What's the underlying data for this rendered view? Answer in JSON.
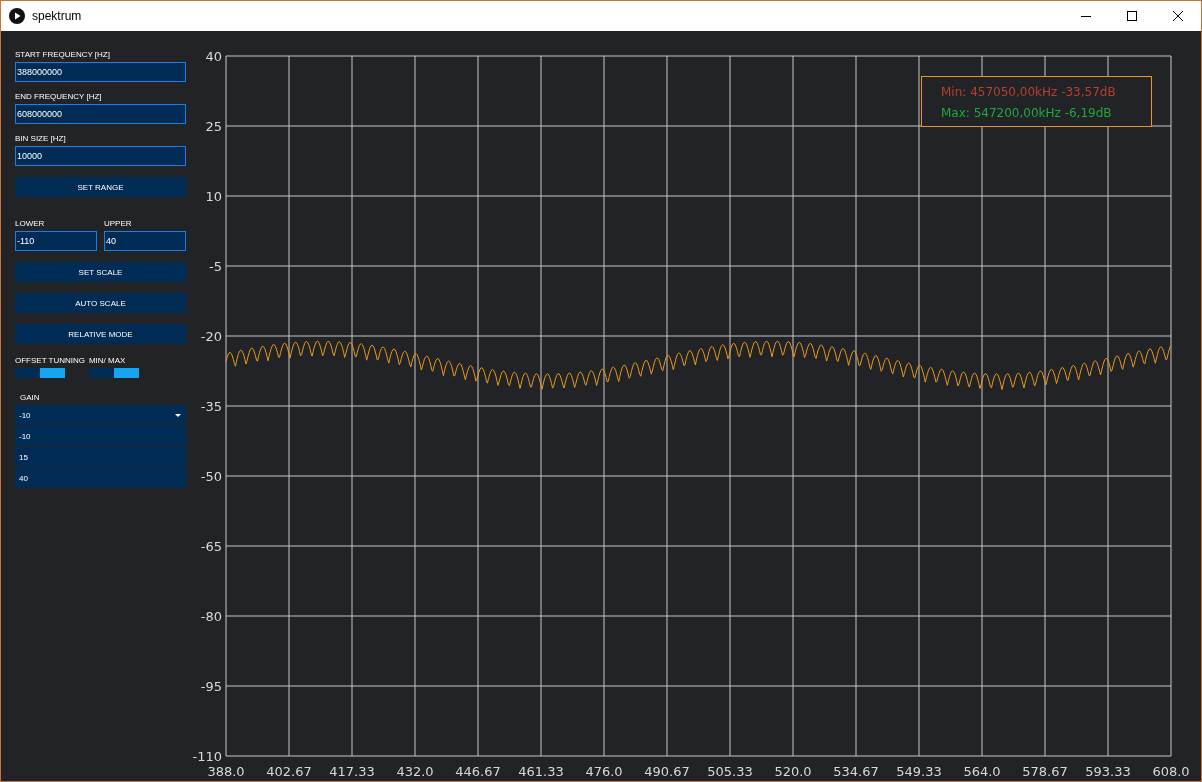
{
  "window": {
    "title": "spektrum"
  },
  "controls": [
    {
      "kind": "field",
      "label": "START FREQUENCY [HZ]",
      "value": "388000000"
    },
    {
      "kind": "field",
      "label": "END FREQUENCY [HZ]",
      "value": "608000000"
    },
    {
      "kind": "field",
      "label": "BIN SIZE [HZ]",
      "value": "10000"
    },
    {
      "kind": "button",
      "label": "SET RANGE"
    },
    {
      "kind": "pair",
      "fields": [
        {
          "label": "LOWER",
          "value": "-110"
        },
        {
          "label": "UPPER",
          "value": "40"
        }
      ]
    },
    {
      "kind": "button",
      "label": "SET SCALE"
    },
    {
      "kind": "button",
      "label": "AUTO SCALE"
    },
    {
      "kind": "button",
      "label": "RELATIVE MODE"
    },
    {
      "kind": "toggles",
      "toggles": [
        {
          "label": "OFFSET TUNNING",
          "on": true
        },
        {
          "label": "MIN/ MAX",
          "on": true
        }
      ]
    },
    {
      "kind": "dropdown",
      "label": "GAIN",
      "value": "-10",
      "options": [
        "-10",
        "15",
        "40"
      ]
    }
  ],
  "plot": {
    "yticks": [
      "40",
      "25",
      "10",
      "-5",
      "-20",
      "-35",
      "-50",
      "-65",
      "-80",
      "-95",
      "-110"
    ],
    "xticks": [
      "388.0",
      "402.67",
      "417.33",
      "432.0",
      "446.67",
      "461.33",
      "476.0",
      "490.67",
      "505.33",
      "520.0",
      "534.67",
      "549.33",
      "564.0",
      "578.67",
      "593.33",
      "608.0"
    ],
    "legend": [
      {
        "text": "Min: 457050,00kHz -33,57dB",
        "color": "#b5402e"
      },
      {
        "text": "Max: 547200,00kHz -6,19dB",
        "color": "#1fa83e"
      }
    ]
  }
}
